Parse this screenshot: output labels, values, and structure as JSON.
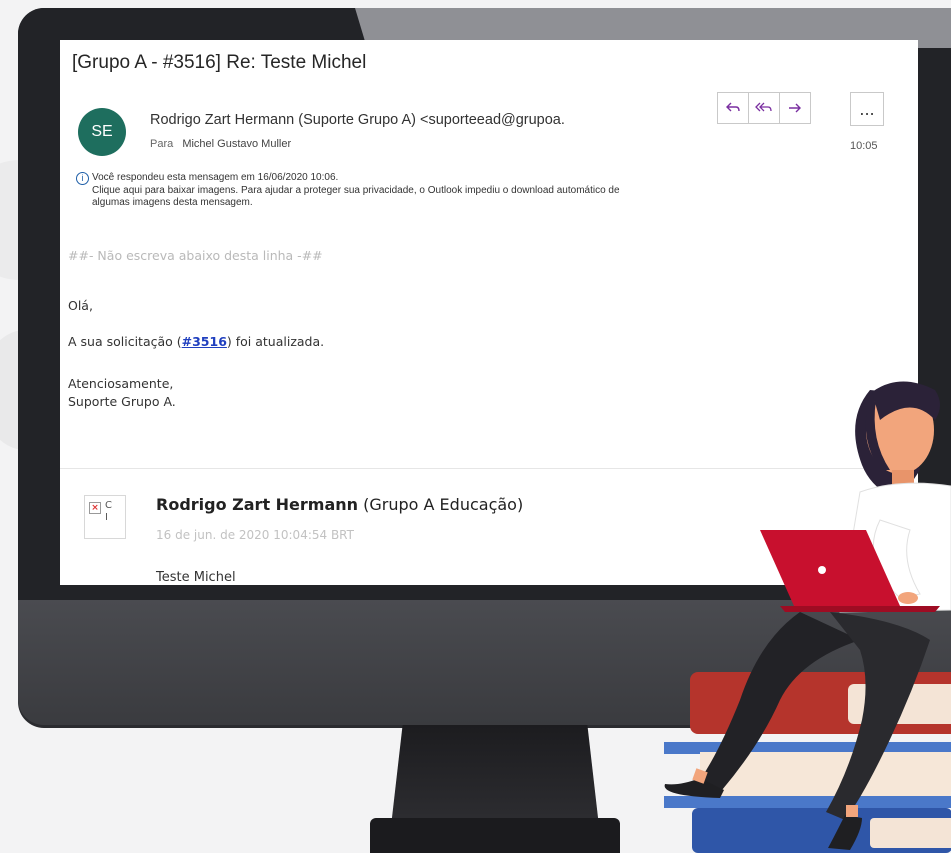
{
  "email": {
    "subject": "[Grupo A - #3516] Re: Teste Michel",
    "avatar_initials": "SE",
    "sender": "Rodrigo Zart Hermann (Suporte Grupo A) <suporteead@grupoa.",
    "to_label": "Para",
    "to_name": "Michel Gustavo Muller",
    "time": "10:05",
    "actions": {
      "reply_icon": "reply-icon",
      "reply_all_icon": "reply-all-icon",
      "forward_icon": "forward-icon",
      "more_label": "..."
    },
    "info_line1": "Você respondeu esta mensagem em 16/06/2020 10:06.",
    "info_line2": "Clique aqui para baixar imagens. Para ajudar a proteger sua privacidade, o Outlook impediu o download automático de",
    "info_line3": "algumas imagens desta mensagem.",
    "body": {
      "separator": "##- Não escreva abaixo desta linha -##",
      "greeting": "Olá,",
      "update_prefix": "A sua solicitação (",
      "update_link": "#3516",
      "update_suffix": ") foi atualizada.",
      "closing": "Atenciosamente,",
      "signature": "Suporte Grupo A."
    },
    "quoted": {
      "author_name": "Rodrigo Zart Hermann",
      "author_org": " (Grupo A Educação)",
      "date": "16 de jun. de 2020 10:04:54 BRT",
      "cut_text": "Teste Michel",
      "broken_image_letters": "C\nI"
    }
  },
  "colors": {
    "avatar": "#1e6e5e",
    "action_icon": "#7a2fa0",
    "link": "#1f3fbf",
    "laptop": "#c8102e"
  }
}
